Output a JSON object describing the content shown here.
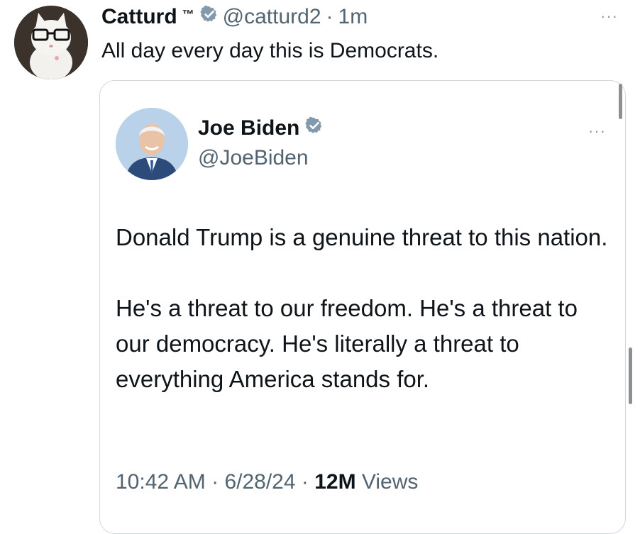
{
  "author": {
    "name": "Catturd",
    "tm": "™",
    "handle": "@catturd2",
    "separator": "·",
    "time": "1m",
    "more": "···"
  },
  "tweet": {
    "text": "All day every day this is Democrats."
  },
  "quote": {
    "name": "Joe Biden",
    "handle": "@JoeBiden",
    "more": "···",
    "paragraphs": [
      "Donald Trump is a genuine threat to this nation.",
      "He's a threat to our freedom. He's a threat to our democracy. He's literally a threat to everything America stands for."
    ],
    "meta": {
      "time": "10:42 AM",
      "sep1": " · ",
      "date": "6/28/24",
      "sep2": " · ",
      "views_count": "12M",
      "views_label": " Views"
    }
  },
  "colors": {
    "verified": "#829aab",
    "secondary": "#536471",
    "text": "#0f1419",
    "border": "#cfd9de"
  },
  "icons": {
    "verified": "verified-badge-icon",
    "more": "more-icon"
  }
}
